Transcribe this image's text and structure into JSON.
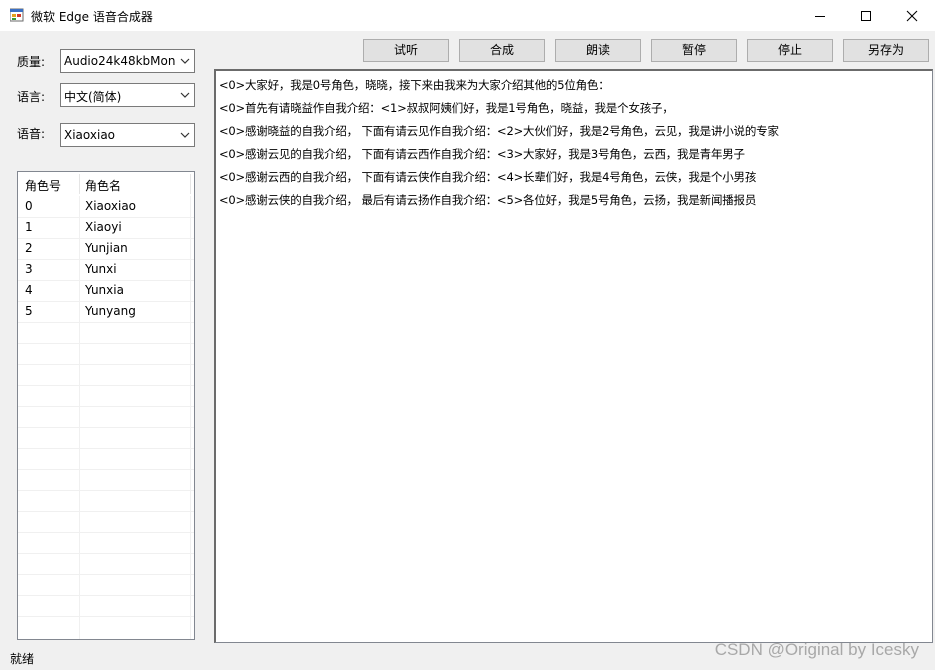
{
  "window": {
    "title": "微软 Edge 语音合成器",
    "controls": [
      "minimize-icon",
      "maximize-icon",
      "close-icon"
    ]
  },
  "settings": {
    "quality_label": "质量:",
    "quality_value": "Audio24k48kbMon",
    "language_label": "语言:",
    "language_value": "中文(简体)",
    "voice_label": "语音:",
    "voice_value": "Xiaoxiao"
  },
  "roles": {
    "columns": [
      "角色号",
      "角色名"
    ],
    "rows": [
      [
        "0",
        "Xiaoxiao"
      ],
      [
        "1",
        "Xiaoyi"
      ],
      [
        "2",
        "Yunjian"
      ],
      [
        "3",
        "Yunxi"
      ],
      [
        "4",
        "Yunxia"
      ],
      [
        "5",
        "Yunyang"
      ]
    ]
  },
  "toolbar": {
    "preview": "试听",
    "synthesize": "合成",
    "read": "朗读",
    "pause": "暂停",
    "stop": "停止",
    "save_as": "另存为"
  },
  "script_lines": [
    "<0>大家好，我是0号角色，晓晓，接下来由我来为大家介绍其他的5位角色：",
    "<0>首先有请晓益作自我介绍：<1>叔叔阿姨们好，我是1号角色，晓益，我是个女孩子，",
    "<0>感谢晓益的自我介绍， 下面有请云见作自我介绍：<2>大伙们好，我是2号角色，云见，我是讲小说的专家",
    "<0>感谢云见的自我介绍， 下面有请云西作自我介绍：<3>大家好，我是3号角色，云西，我是青年男子",
    "<0>感谢云西的自我介绍， 下面有请云侠作自我介绍：<4>长辈们好，我是4号角色，云侠，我是个小男孩",
    "<0>感谢云侠的自我介绍， 最后有请云扬作自我介绍：<5>各位好，我是5号角色，云扬，我是新闻播报员"
  ],
  "status": {
    "text": "就绪"
  },
  "watermark": "CSDN @Original by Icesky"
}
